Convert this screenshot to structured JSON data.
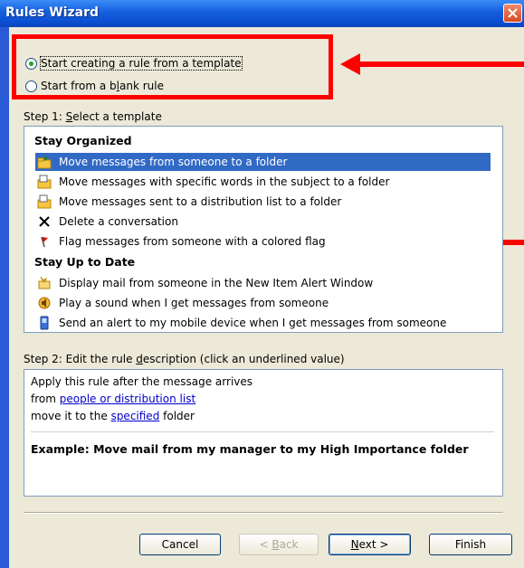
{
  "window": {
    "title": "Rules Wizard"
  },
  "options": {
    "template_label_pre": "Start creating a rule from a template",
    "blank_pre": "Start from a b",
    "blank_key": "l",
    "blank_post": "ank rule"
  },
  "step1": {
    "pre": "Step 1: ",
    "key": "S",
    "post": "elect a template"
  },
  "groups": {
    "organized": "Stay Organized",
    "uptodate": "Stay Up to Date"
  },
  "items": [
    "Move messages from someone to a folder",
    "Move messages with specific words in the subject to a folder",
    "Move messages sent to a distribution list to a folder",
    "Delete a conversation",
    "Flag messages from someone with a colored flag",
    "Display mail from someone in the New Item Alert Window",
    "Play a sound when I get messages from someone",
    "Send an alert to my mobile device when I get messages from someone"
  ],
  "step2": {
    "pre": "Step 2: Edit the rule ",
    "key": "d",
    "post": "escription (click an underlined value)"
  },
  "description": {
    "line1": "Apply this rule after the message arrives",
    "line2_pre": "from ",
    "line2_link": "people or distribution list",
    "line3_pre": "move it to the ",
    "line3_link": "specified",
    "line3_post": " folder",
    "example": "Example: Move mail from my manager to my High Importance folder"
  },
  "buttons": {
    "cancel": "Cancel",
    "back_pre": "< ",
    "back_key": "B",
    "back_post": "ack",
    "next_key": "N",
    "next_post": "ext >",
    "finish": "Finish"
  },
  "colors": {
    "annotation": "#ff0000",
    "selection": "#316ac5",
    "title_bar": "#0b4fd1"
  }
}
